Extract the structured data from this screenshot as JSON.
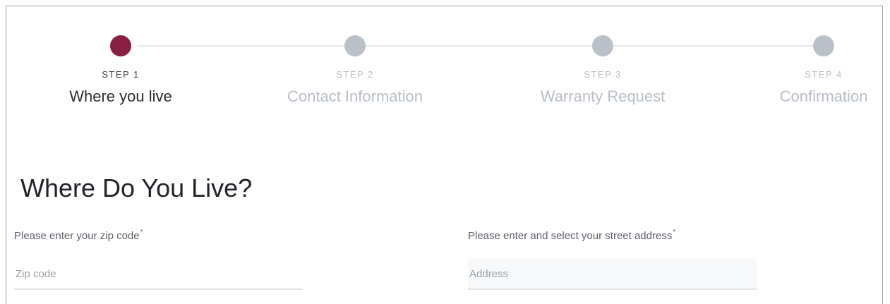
{
  "stepper": {
    "steps": [
      {
        "number": "STEP 1",
        "title": "Where you live",
        "active": true
      },
      {
        "number": "STEP 2",
        "title": "Contact Information",
        "active": false
      },
      {
        "number": "STEP 3",
        "title": "Warranty Request",
        "active": false
      },
      {
        "number": "STEP 4",
        "title": "Confirmation",
        "active": false
      }
    ]
  },
  "colors": {
    "active_step": "#8a1f43",
    "inactive_step": "#b9c0c8"
  },
  "form": {
    "heading": "Where Do You Live?",
    "zip": {
      "label": "Please enter your zip code",
      "required_mark": "*",
      "placeholder": "Zip code",
      "value": ""
    },
    "address": {
      "label": "Please enter and select your street address",
      "required_mark": "*",
      "placeholder": "Address",
      "value": ""
    }
  }
}
